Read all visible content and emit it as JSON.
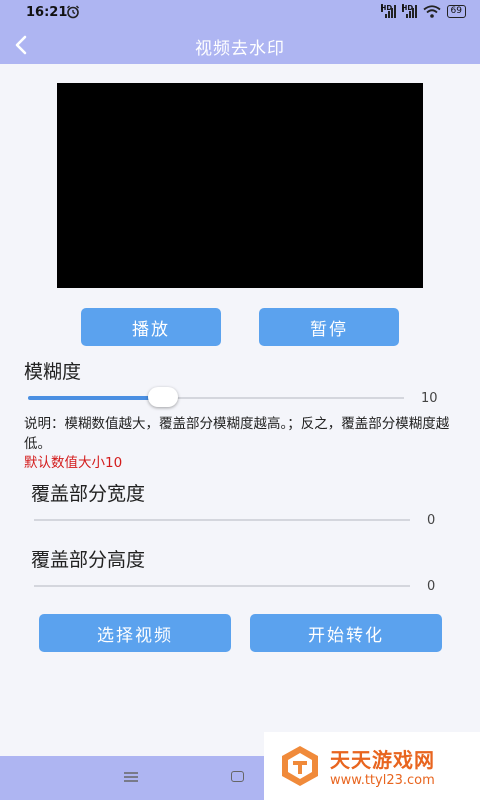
{
  "status_bar": {
    "time": "16:21",
    "battery": "69",
    "signal_label": "HD"
  },
  "app_bar": {
    "title": "视频去水印"
  },
  "controls": {
    "play_label": "播放",
    "pause_label": "暂停"
  },
  "blur": {
    "label": "模糊度",
    "value": "10",
    "slider_fraction": 0.36,
    "description": "说明：模糊数值越大，覆盖部分模糊度越高。；反之，覆盖部分模糊度越低。",
    "default_note": "默认数值大小10"
  },
  "cover_width": {
    "label": "覆盖部分宽度",
    "value": "0"
  },
  "cover_height": {
    "label": "覆盖部分高度",
    "value": "0"
  },
  "actions": {
    "select_video_label": "选择视频",
    "convert_label": "开始转化"
  },
  "watermark": {
    "name": "天天游戏网",
    "url": "www.ttyl23.com"
  },
  "colors": {
    "accent": "#5ba2ee",
    "bar": "#aeb5f2",
    "warning": "#d31b1b"
  }
}
